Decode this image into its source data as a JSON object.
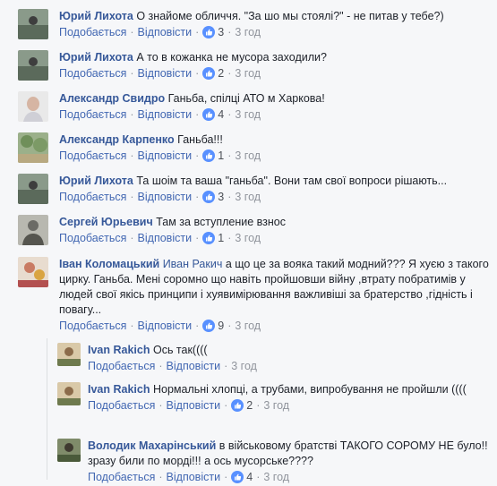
{
  "comments": [
    {
      "author": "Юрий Лихота",
      "text": "О знайоме обличчя. \"За шо мы стоялі?\" - не питав у тебе?)",
      "like": "Подобається",
      "reply": "Відповісти",
      "count": "3",
      "time": "3 год"
    },
    {
      "author": "Юрий Лихота",
      "text": "А то в кожанка не мусора заходили?",
      "like": "Подобається",
      "reply": "Відповісти",
      "count": "2",
      "time": "3 год"
    },
    {
      "author": "Александр Свидро",
      "text": "Ганьба, спілці АТО м Харкова!",
      "like": "Подобається",
      "reply": "Відповісти",
      "count": "4",
      "time": "3 год"
    },
    {
      "author": "Александр Карпенко",
      "text": "Ганьба!!!",
      "like": "Подобається",
      "reply": "Відповісти",
      "count": "1",
      "time": "3 год"
    },
    {
      "author": "Юрий Лихота",
      "text": "Та шоім та ваша \"ганьба\". Вони там свої вопроси рішають...",
      "like": "Подобається",
      "reply": "Відповісти",
      "count": "3",
      "time": "3 год"
    },
    {
      "author": "Сергей Юрьевич",
      "text": "Там за вступление взнос",
      "like": "Подобається",
      "reply": "Відповісти",
      "count": "1",
      "time": "3 год"
    },
    {
      "author": "Іван Коломацький",
      "mention": "Иван Ракич",
      "text": " а що це за вояка такий модний??? Я хуєю з такого цирку. Ганьба. Мені соромно що навіть пройшовши війну ,втрату побратимів у людей свої якісь принципи і хуявимірювання важливіші за братерство ,гідність і повагу...",
      "like": "Подобається",
      "reply": "Відповісти",
      "count": "9",
      "time": "3 год"
    }
  ],
  "replies": [
    {
      "author": "Ivan Rakich",
      "text": "Ось так((((",
      "like": "Подобається",
      "reply": "Відповісти",
      "time": "3 год"
    },
    {
      "author": "Ivan Rakich",
      "text": "Нормальні хлопці, а трубами, випробування не пройшли ((((",
      "like": "Подобається",
      "reply": "Відповісти",
      "count": "2",
      "time": "3 год"
    },
    {
      "author": "Володик Махарінський",
      "text": "в військовому братстві ТАКОГО СОРОМУ НЕ було!! зразу били по морді!!! а ось мусорське????",
      "like": "Подобається",
      "reply": "Відповісти",
      "count": "4",
      "time": "3 год"
    }
  ],
  "colors": {
    "link": "#4267b2",
    "author": "#365899",
    "meta": "#90949c",
    "like_badge": "#5890ff"
  }
}
